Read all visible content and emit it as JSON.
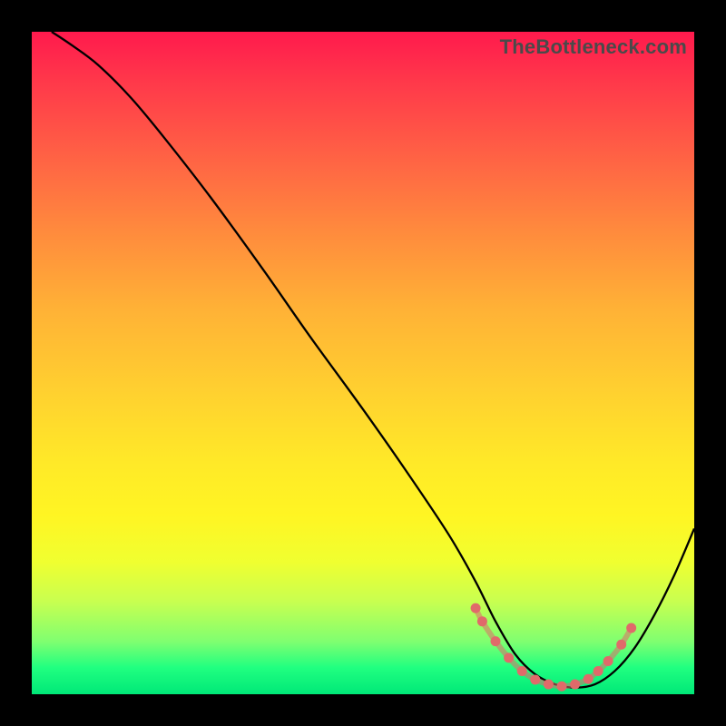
{
  "watermark": "TheBottleneck.com",
  "chart_data": {
    "type": "line",
    "title": "",
    "xlabel": "",
    "ylabel": "",
    "xlim": [
      0,
      100
    ],
    "ylim": [
      0,
      100
    ],
    "series": [
      {
        "name": "curve",
        "x": [
          3,
          6,
          10,
          15,
          20,
          27,
          35,
          42,
          50,
          57,
          63,
          67,
          70,
          73,
          76,
          79,
          82,
          85,
          88,
          91,
          94,
          97,
          100
        ],
        "y": [
          100,
          98,
          95,
          90,
          84,
          75,
          64,
          54,
          43,
          33,
          24,
          17,
          11,
          6,
          3,
          1.5,
          1,
          1.5,
          3.5,
          7,
          12,
          18,
          25
        ]
      }
    ],
    "markers": {
      "name": "flat-segment-dots",
      "color": "#e06a6a",
      "x": [
        67,
        68,
        70,
        72,
        74,
        76,
        78,
        80,
        82,
        84,
        85.5,
        87,
        89,
        90.5
      ],
      "y": [
        13,
        11,
        8,
        5.5,
        3.5,
        2.2,
        1.5,
        1.2,
        1.5,
        2.3,
        3.5,
        5,
        7.5,
        10
      ]
    }
  }
}
